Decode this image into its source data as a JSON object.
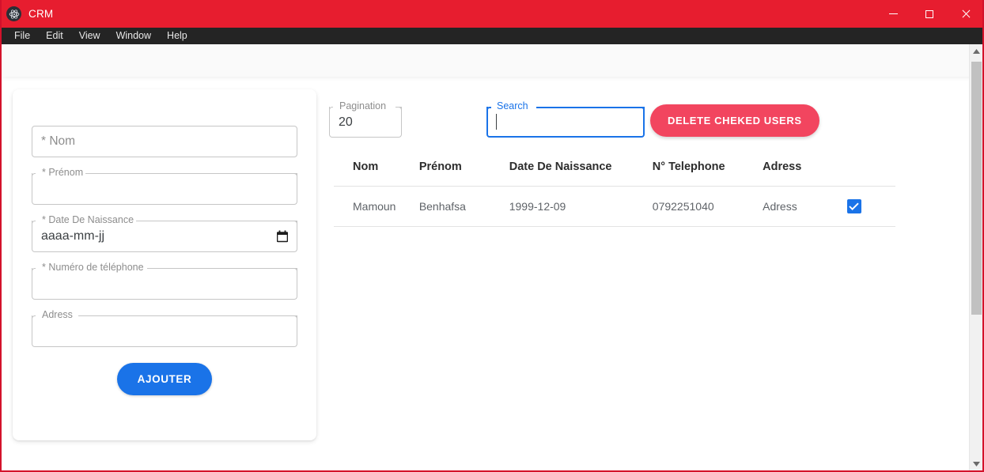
{
  "window": {
    "title": "CRM",
    "app_icon": "electron-atom-icon",
    "controls": {
      "minimize": "minimize-icon",
      "maximize": "maximize-icon",
      "close": "close-icon"
    },
    "titlebar_color": "#e71d2f",
    "menubar_color": "#242424"
  },
  "menu": {
    "items": [
      "File",
      "Edit",
      "View",
      "Window",
      "Help"
    ]
  },
  "form": {
    "fields": [
      {
        "label": "* Nom",
        "value": "",
        "placeholder": "* Nom",
        "floating": false,
        "type": "text"
      },
      {
        "label": "* Prénom",
        "value": "",
        "placeholder": "",
        "floating": true,
        "type": "text"
      },
      {
        "label": "* Date De Naissance",
        "value": "aaaa-mm-jj",
        "placeholder": "aaaa-mm-jj",
        "floating": true,
        "type": "date"
      },
      {
        "label": "* Numéro de téléphone",
        "value": "",
        "placeholder": "",
        "floating": true,
        "type": "text"
      },
      {
        "label": "Adress",
        "value": "",
        "placeholder": "",
        "floating": true,
        "type": "text"
      }
    ],
    "submit_label": "AJOUTER",
    "submit_color": "#1a73e8"
  },
  "toolbar": {
    "pagination": {
      "label": "Pagination",
      "value": "20"
    },
    "search": {
      "label": "Search",
      "value": "",
      "focused": true,
      "accent": "#1a73e8"
    },
    "delete_button": {
      "label": "DELETE CHEKED USERS",
      "color": "#f2455f"
    }
  },
  "table": {
    "headers": [
      "Nom",
      "Prénom",
      "Date De Naissance",
      "N° Telephone",
      "Adress",
      ""
    ],
    "rows": [
      {
        "nom": "Mamoun",
        "prenom": "Benhafsa",
        "date_naissance": "1999-12-09",
        "telephone": "0792251040",
        "adress": "Adress",
        "checked": true
      }
    ],
    "checkbox_color": "#1a73e8"
  },
  "scrollbar": {
    "up_arrow": "scroll-up-icon",
    "down_arrow": "scroll-down-icon",
    "thumb": "scroll-thumb"
  }
}
